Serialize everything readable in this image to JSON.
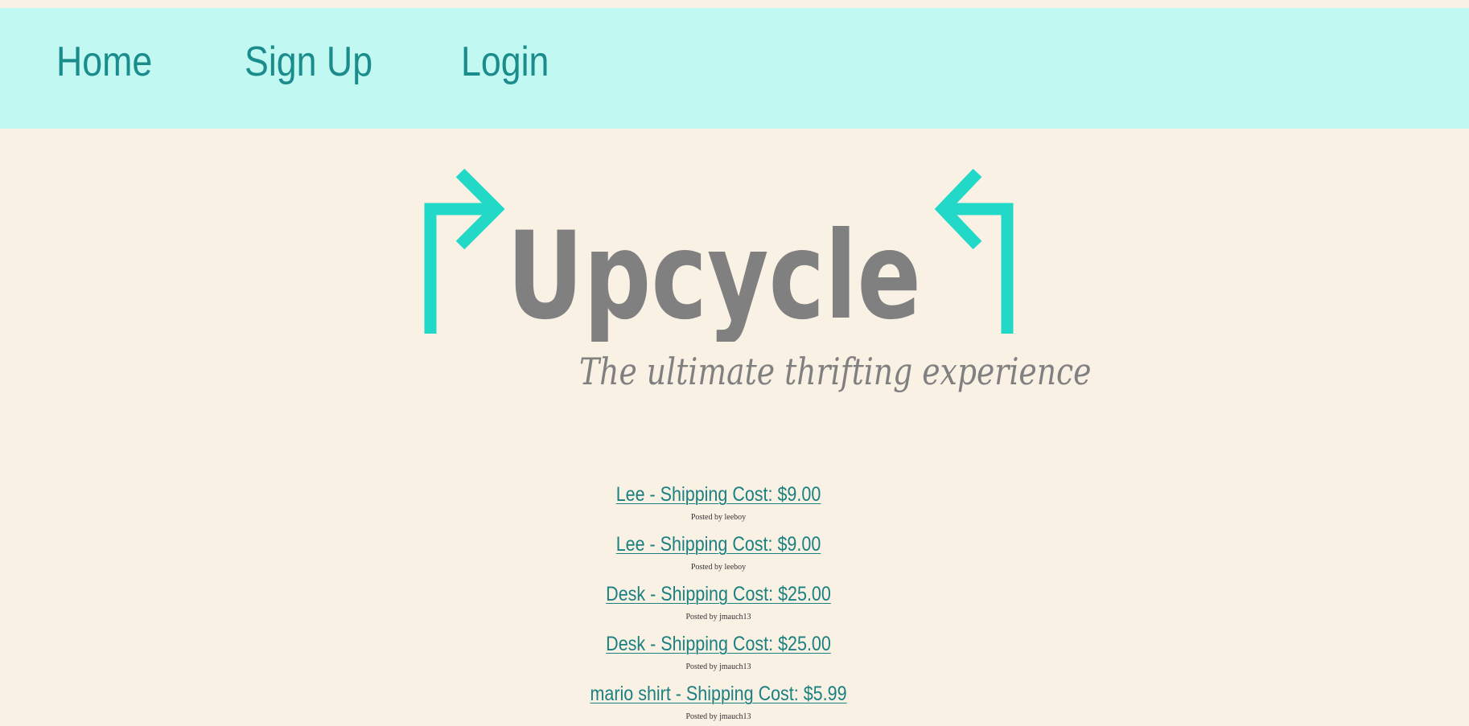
{
  "nav": {
    "home": "Home",
    "signup": "Sign Up",
    "login": "Login"
  },
  "logo": {
    "wordmark": "Upcycle",
    "tagline": "The ultimate thrifting experience"
  },
  "colors": {
    "background": "#faf1e5",
    "navbar": "#c1f8f1",
    "nav_text": "#1a8c8c",
    "accent_arrow": "#22d9c8",
    "logo_text": "#808080",
    "link": "#1a8080"
  },
  "posts": [
    {
      "title": "Lee - Shipping Cost: $9.00",
      "author": "Posted by leeboy"
    },
    {
      "title": "Lee - Shipping Cost: $9.00",
      "author": "Posted by leeboy"
    },
    {
      "title": "Desk - Shipping Cost: $25.00",
      "author": "Posted by jmauch13"
    },
    {
      "title": "Desk - Shipping Cost: $25.00",
      "author": "Posted by jmauch13"
    },
    {
      "title": "mario shirt - Shipping Cost: $5.99",
      "author": "Posted by jmauch13"
    }
  ]
}
